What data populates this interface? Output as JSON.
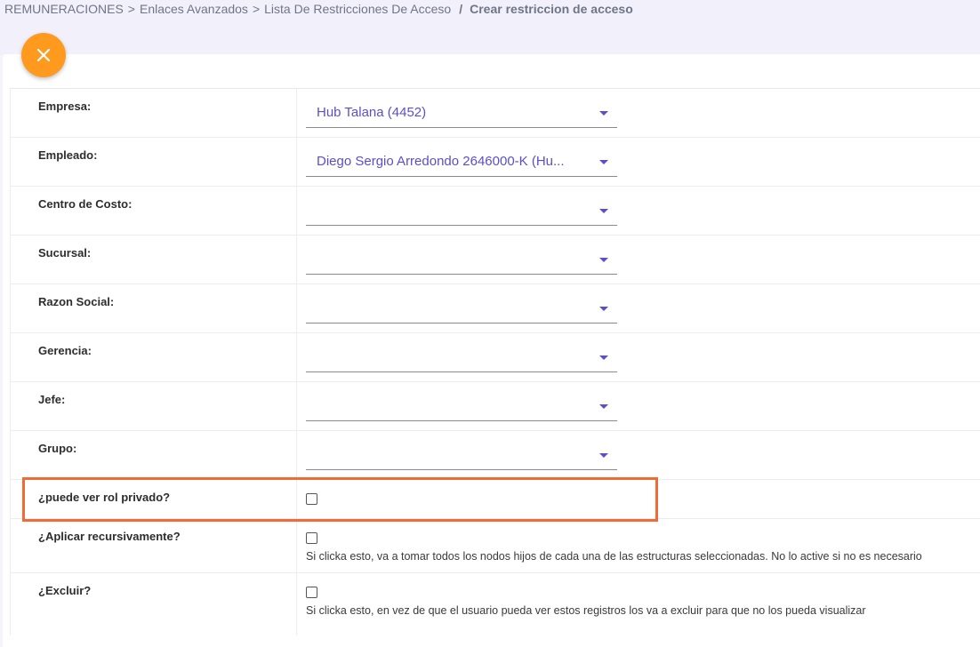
{
  "breadcrumb": {
    "items": [
      "REMUNERACIONES",
      "Enlaces Avanzados",
      "Lista De Restricciones De Acceso"
    ],
    "current": "Crear restriccion de acceso"
  },
  "form": {
    "empresa": {
      "label": "Empresa:",
      "value": "Hub Talana (4452)"
    },
    "empleado": {
      "label": "Empleado:",
      "value": "Diego Sergio Arredondo 2646000-K (Hu..."
    },
    "centro_costo": {
      "label": "Centro de Costo:",
      "value": ""
    },
    "sucursal": {
      "label": "Sucursal:",
      "value": ""
    },
    "razon_social": {
      "label": "Razon Social:",
      "value": ""
    },
    "gerencia": {
      "label": "Gerencia:",
      "value": ""
    },
    "jefe": {
      "label": "Jefe:",
      "value": ""
    },
    "grupo": {
      "label": "Grupo:",
      "value": ""
    },
    "rol_privado": {
      "label": "¿puede ver rol privado?",
      "checked": false
    },
    "recursivo": {
      "label": "¿Aplicar recursivamente?",
      "checked": false,
      "hint": "Si clicka esto, va a tomar todos los nodos hijos de cada una de las estructuras seleccionadas. No lo active si no es necesario"
    },
    "excluir": {
      "label": "¿Excluir?",
      "checked": false,
      "hint": "Si clicka esto, en vez de que el usuario pueda ver estos registros los va a excluir para que no los pueda visualizar"
    }
  },
  "colors": {
    "accent": "#5b4fc9",
    "close_button": "#ff9a1f",
    "highlight": "#f26a35"
  },
  "icons": {
    "close": "close-icon",
    "dropdown": "caret-down-icon"
  }
}
